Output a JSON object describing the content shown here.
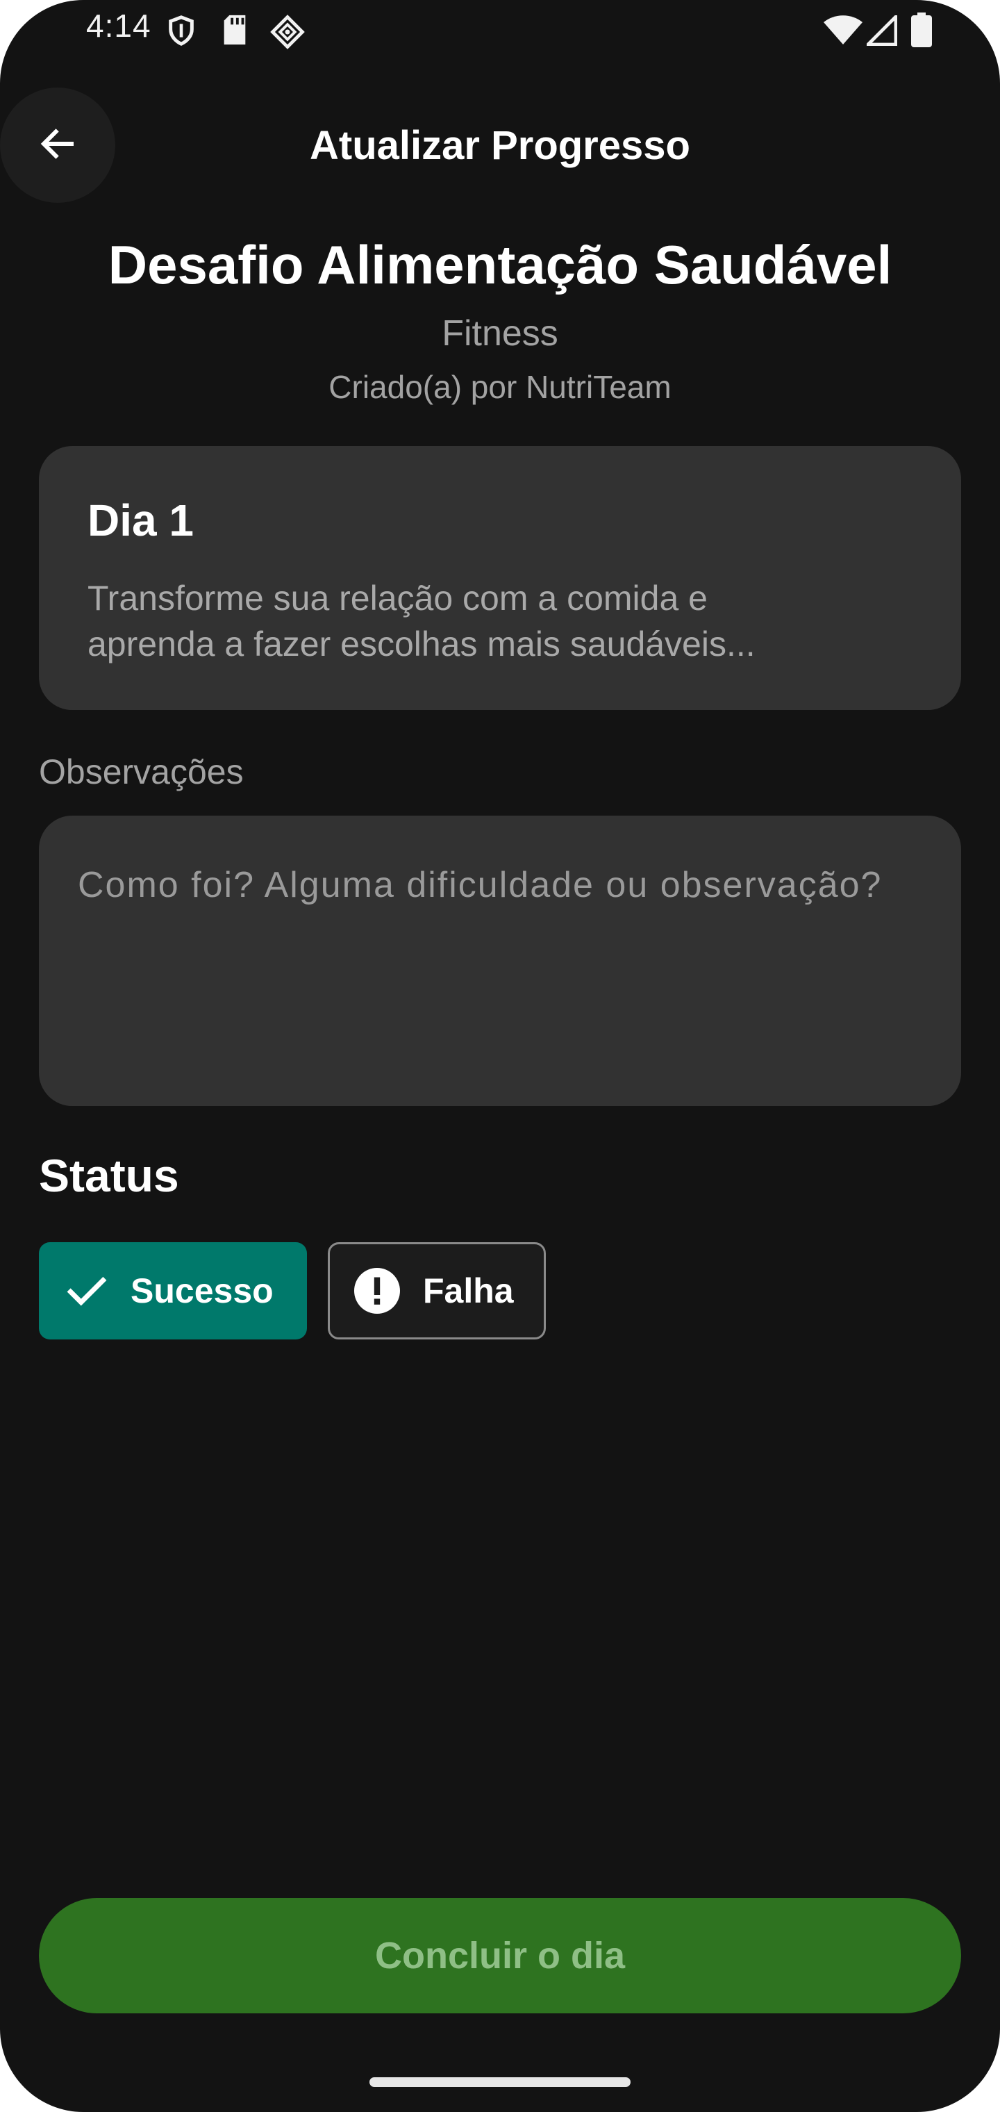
{
  "status_bar": {
    "time": "4:14",
    "icons": [
      "shield-icon",
      "sd-card-icon",
      "data-saver-icon",
      "wifi-icon",
      "cell-signal-icon",
      "battery-icon"
    ]
  },
  "header": {
    "back_icon": "arrow-left-icon",
    "title": "Atualizar Progresso"
  },
  "challenge": {
    "title": "Desafio Alimentação Saudável",
    "category": "Fitness",
    "author": "Criado(a) por NutriTeam"
  },
  "day_card": {
    "title": "Dia 1",
    "description_line1": "Transforme sua relação com a comida e",
    "description_line2": "aprenda a fazer escolhas mais saudáveis..."
  },
  "notes": {
    "label": "Observações",
    "placeholder": "Como foi? Alguma dificuldade ou observação?",
    "value": ""
  },
  "status": {
    "heading": "Status",
    "options": [
      {
        "label": "Sucesso",
        "icon": "check-icon",
        "selected": true
      },
      {
        "label": "Falha",
        "icon": "alert-circle-icon",
        "selected": false
      }
    ]
  },
  "actions": {
    "complete_label": "Concluir o dia"
  },
  "colors": {
    "background": "#131313",
    "surface": "#323232",
    "success_chip": "#00796b",
    "primary_button": "#2e7320",
    "primary_button_text": "#8fbf86",
    "muted_text": "#a3a3a3"
  }
}
